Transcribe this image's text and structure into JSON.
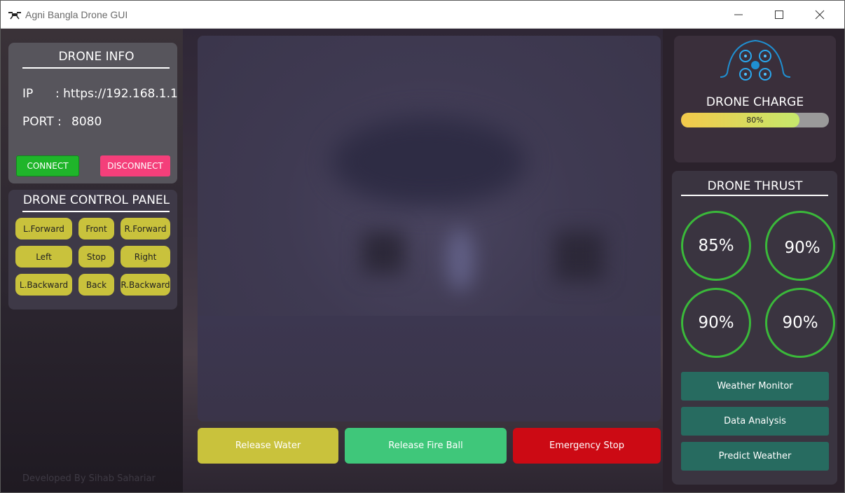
{
  "window": {
    "title": "Agni Bangla Drone GUI",
    "app_icon": "drone-icon",
    "minimize_icon": "minimize-icon",
    "maximize_icon": "maximize-icon",
    "close_icon": "close-icon"
  },
  "drone_info": {
    "title": "DRONE INFO",
    "ip_label": "IP",
    "ip_value": ": https://192.168.1.1",
    "port_label": "PORT :",
    "port_value": "8080",
    "connect_label": "CONNECT",
    "disconnect_label": "DISCONNECT"
  },
  "control_panel": {
    "title": "DRONE CONTROL PANEL",
    "buttons": [
      {
        "label": "L.Forward"
      },
      {
        "label": "Front"
      },
      {
        "label": "R.Forward"
      },
      {
        "label": "Left"
      },
      {
        "label": "Stop"
      },
      {
        "label": "Right"
      },
      {
        "label": "L.Backward"
      },
      {
        "label": "Back"
      },
      {
        "label": "R.Backward"
      }
    ]
  },
  "actions": {
    "release_water": "Release Water",
    "release_fire_ball": "Release Fire Ball",
    "emergency_stop": "Emergency Stop"
  },
  "footer": {
    "credit": "Developed By Sihab Sahariar"
  },
  "drone_charge": {
    "title": "DRONE CHARGE",
    "value_text": "80%",
    "value": 0.8
  },
  "drone_thrust": {
    "title": "DRONE THRUST",
    "motors": [
      "85%",
      "90%",
      "90%",
      "90%"
    ]
  },
  "side_buttons": {
    "weather_monitor": "Weather Monitor",
    "data_analysis": "Data Analysis",
    "predict_weather": "Predict Weather"
  },
  "colors": {
    "connect": "#1fb52a",
    "disconnect": "#f43f7a",
    "control_button": "#c9c23c",
    "fire_ball": "#3fc77a",
    "emergency": "#cc0a14",
    "thrust_ring": "#3ab93a",
    "side_button": "#276b60"
  }
}
